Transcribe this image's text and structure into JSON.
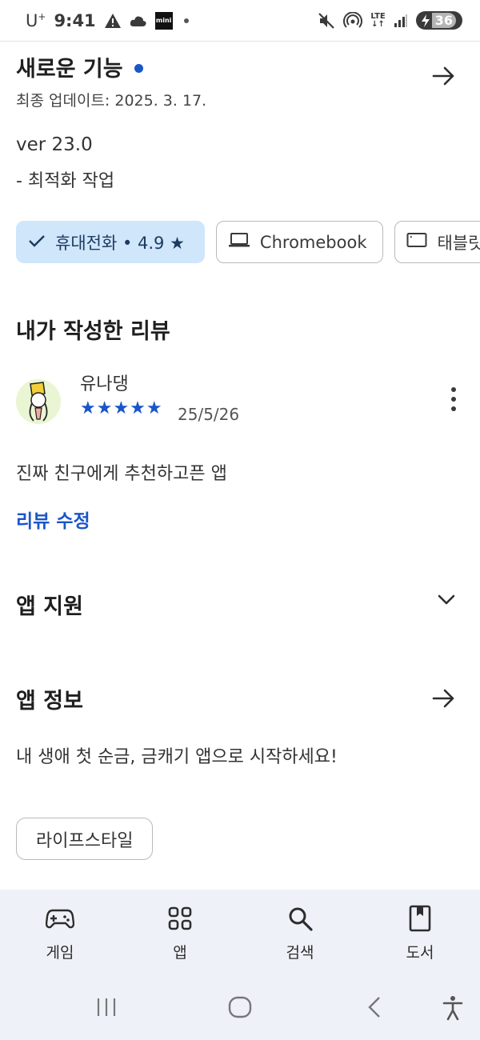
{
  "status_bar": {
    "carrier": "U",
    "carrier_sup": "+",
    "time": "9:41",
    "mini_label": "mini",
    "lte_label": "LTE",
    "battery": "36",
    "icons": [
      "warning-icon",
      "cloud-icon",
      "mini-app-icon",
      "dot-icon",
      "mute-icon",
      "hotspot-icon",
      "lte-icon",
      "signal-icon",
      "battery-charging-icon"
    ]
  },
  "whats_new": {
    "title": "새로운 기능",
    "updated": "최종 업데이트: 2025. 3. 17.",
    "version": "ver 23.0",
    "notes": "- 최적화 작업"
  },
  "device_chips": [
    {
      "label": "휴대전화 • 4.9 ★",
      "icon": "check-icon",
      "selected": true
    },
    {
      "label": "Chromebook",
      "icon": "laptop-icon",
      "selected": false
    },
    {
      "label": "태블릿",
      "icon": "tablet-icon",
      "selected": false
    }
  ],
  "my_review": {
    "section_title": "내가 작성한 리뷰",
    "reviewer": "유나댕",
    "rating": 5,
    "stars": "★★★★★",
    "date": "25/5/26",
    "text": "진짜 친구에게 추천하고픈 앱",
    "edit_label": "리뷰 수정"
  },
  "app_support": {
    "title": "앱 지원"
  },
  "app_info": {
    "title": "앱 정보",
    "description": "내 생애 첫 순금, 금캐기 앱으로 시작하세요!",
    "category": "라이프스타일"
  },
  "bottom_nav": [
    {
      "label": "게임",
      "icon": "gamepad-icon"
    },
    {
      "label": "앱",
      "icon": "apps-grid-icon"
    },
    {
      "label": "검색",
      "icon": "search-icon"
    },
    {
      "label": "도서",
      "icon": "book-icon"
    }
  ],
  "colors": {
    "accent": "#1a56c8",
    "chip_selected_bg": "#cfe6fb",
    "nav_bg": "#eef2f8"
  }
}
